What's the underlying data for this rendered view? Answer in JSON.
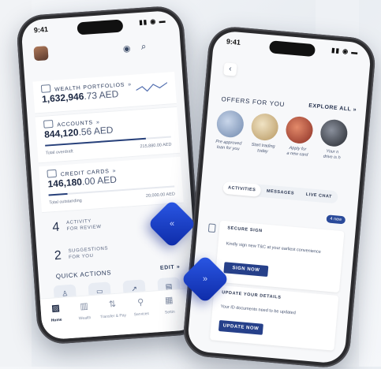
{
  "phone_left": {
    "status_time": "9:41",
    "wealth": {
      "label": "WEALTH PORTFOLIOS",
      "amount_main": "1,632,946",
      "amount_dec": ".73 AED"
    },
    "accounts": {
      "label": "ACCOUNTS",
      "amount_main": "844,120",
      "amount_dec": ".56 AED",
      "sub_label": "Total overdraft",
      "sub_value": "215,880.00 AED",
      "used_fraction": 0.8
    },
    "credit_cards": {
      "label": "CREDIT CARDS",
      "amount_main": "146,180",
      "amount_dec": ".00 AED",
      "sub_label": "Total outstanding",
      "sub_value": "20,000.00 AED",
      "used_fraction": 0.15
    },
    "activity": {
      "count": "4",
      "line1": "ACTIVITY",
      "line2": "FOR REVIEW"
    },
    "suggestions": {
      "count": "2",
      "line1": "SUGGESTIONS",
      "line2": "FOR YOU"
    },
    "quick_actions": {
      "title": "QUICK ACTIONS",
      "edit": "EDIT"
    },
    "tabs": [
      {
        "label": "Home",
        "icon": "home-icon"
      },
      {
        "label": "Wealth",
        "icon": "chart-icon"
      },
      {
        "label": "Transfer & Pay",
        "icon": "transfer-icon"
      },
      {
        "label": "Services",
        "icon": "services-icon"
      },
      {
        "label": "Settin",
        "icon": "settings-icon"
      }
    ]
  },
  "phone_right": {
    "status_time": "9:41",
    "offers_title": "OFFERS FOR YOU",
    "explore_all": "EXPLORE ALL",
    "offers": [
      {
        "line1": "Pre approved",
        "line2": "loan for you",
        "color": "#7b95b8"
      },
      {
        "line1": "Start trading",
        "line2": "today",
        "color": "#c7b088"
      },
      {
        "line1": "Apply for",
        "line2": "a new card",
        "color": "#a44a3c"
      },
      {
        "line1": "Your n",
        "line2": "drive is h",
        "color": "#3b3f48"
      }
    ],
    "segments": [
      "ACTIVITIES",
      "MESSAGES",
      "LIVE CHAT"
    ],
    "new_badge": "4 new",
    "messages": [
      {
        "title": "SECURE SIGN",
        "body": "Kindly sign new T&C at your earliest convenience",
        "button": "SIGN NOW"
      },
      {
        "title": "UPDATE YOUR DETAILS",
        "body": "Your ID documents need to be updated",
        "button": "UPDATE NOW"
      }
    ]
  },
  "colors": {
    "brand_navy": "#26408a",
    "accent_blue": "#2b58e6"
  }
}
